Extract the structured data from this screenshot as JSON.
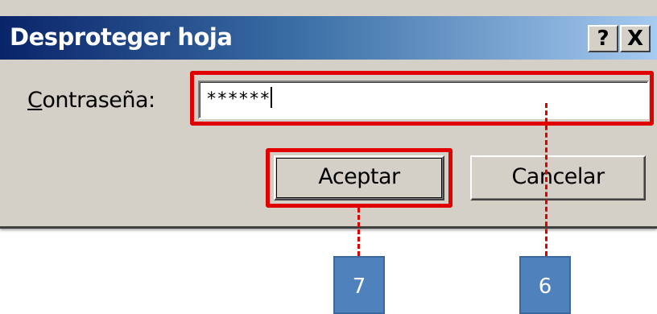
{
  "dialog": {
    "title": "Desproteger hoja",
    "help_button": "?",
    "close_button": "X",
    "password_label_accel": "C",
    "password_label_rest": "ontraseña:",
    "password_value": "******",
    "ok_label": "Aceptar",
    "cancel_label": "Cancelar"
  },
  "annotations": {
    "callout_ok": "7",
    "callout_password": "6",
    "highlight_color": "#e00000",
    "badge_color": "#4f81bd"
  },
  "icons": {
    "help": "question-mark-icon",
    "close": "close-icon"
  }
}
